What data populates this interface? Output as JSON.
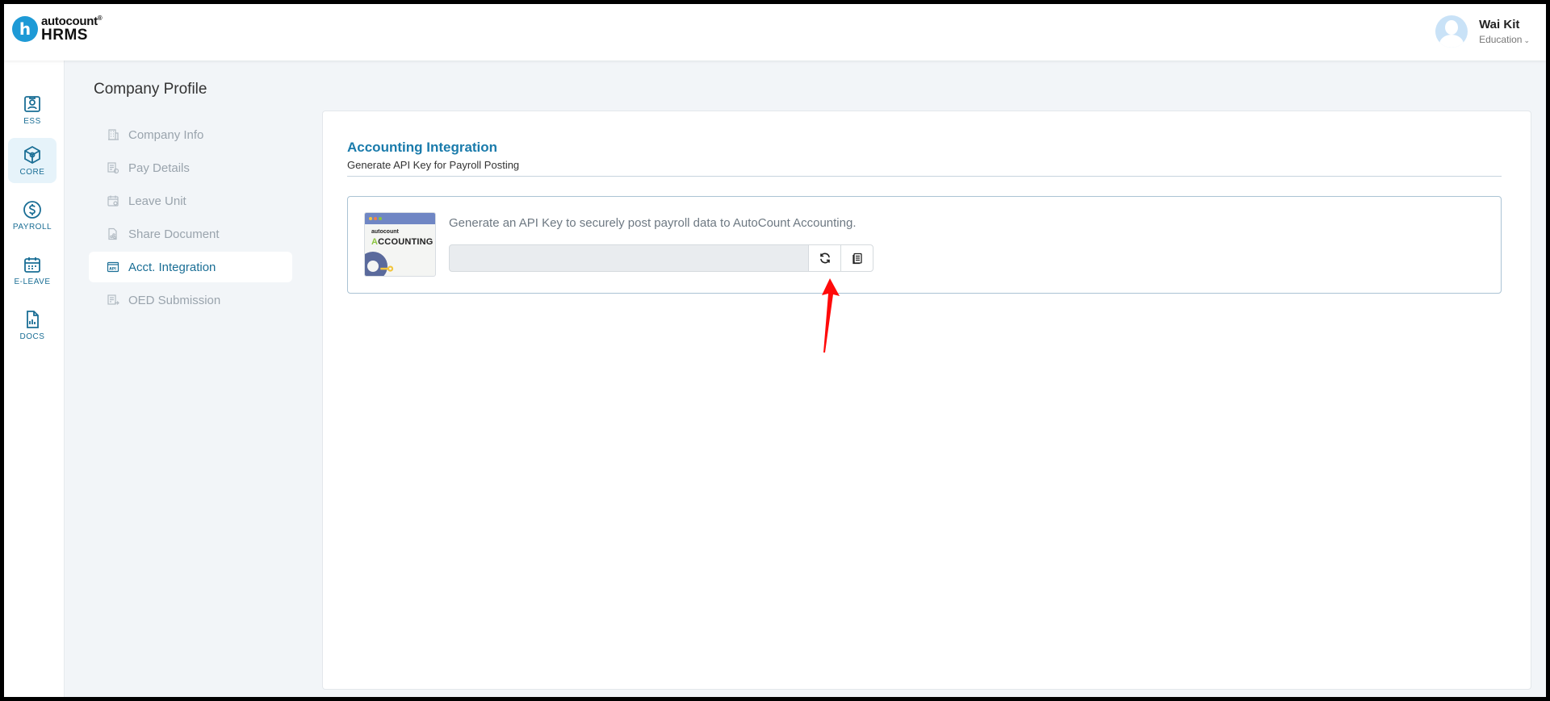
{
  "header": {
    "logo": {
      "mark": "h",
      "brand_top": "autocount",
      "brand_reg": "®",
      "brand_bottom": "HRMS"
    },
    "user": {
      "name": "Wai Kit",
      "org": "Education",
      "chevron": "⌄"
    }
  },
  "leftnav": [
    {
      "label": "ESS",
      "icon": "badge-icon",
      "active": false
    },
    {
      "label": "CORE",
      "icon": "cube-icon",
      "active": true
    },
    {
      "label": "PAYROLL",
      "icon": "dollar-icon",
      "active": false
    },
    {
      "label": "E-LEAVE",
      "icon": "calendar-icon",
      "active": false
    },
    {
      "label": "DOCS",
      "icon": "document-chart-icon",
      "active": false
    }
  ],
  "page": {
    "title": "Company Profile",
    "submenu": [
      {
        "label": "Company Info",
        "icon": "building-icon",
        "active": false
      },
      {
        "label": "Pay Details",
        "icon": "pay-icon",
        "active": false
      },
      {
        "label": "Leave Unit",
        "icon": "calendar-icon",
        "active": false
      },
      {
        "label": "Share Document",
        "icon": "share-document-icon",
        "active": false
      },
      {
        "label": "Acct. Integration",
        "icon": "api-icon",
        "active": true
      },
      {
        "label": "OED Submission",
        "icon": "submission-icon",
        "active": false
      }
    ]
  },
  "card": {
    "title": "Accounting Integration",
    "subtitle": "Generate API Key for Payroll Posting",
    "thumb": {
      "brand": "autocount",
      "word_first": "A",
      "word_rest": "CCOUNTING"
    },
    "description": "Generate an API Key to securely post payroll data to AutoCount Accounting.",
    "api_key_value": "",
    "refresh_icon": "refresh-icon",
    "copy_icon": "copy-icon"
  },
  "colors": {
    "accent": "#1a7bab",
    "nav": "#1a6e95",
    "nav_active_bg": "#e6f3fa",
    "annotation_arrow": "#ff0000"
  }
}
